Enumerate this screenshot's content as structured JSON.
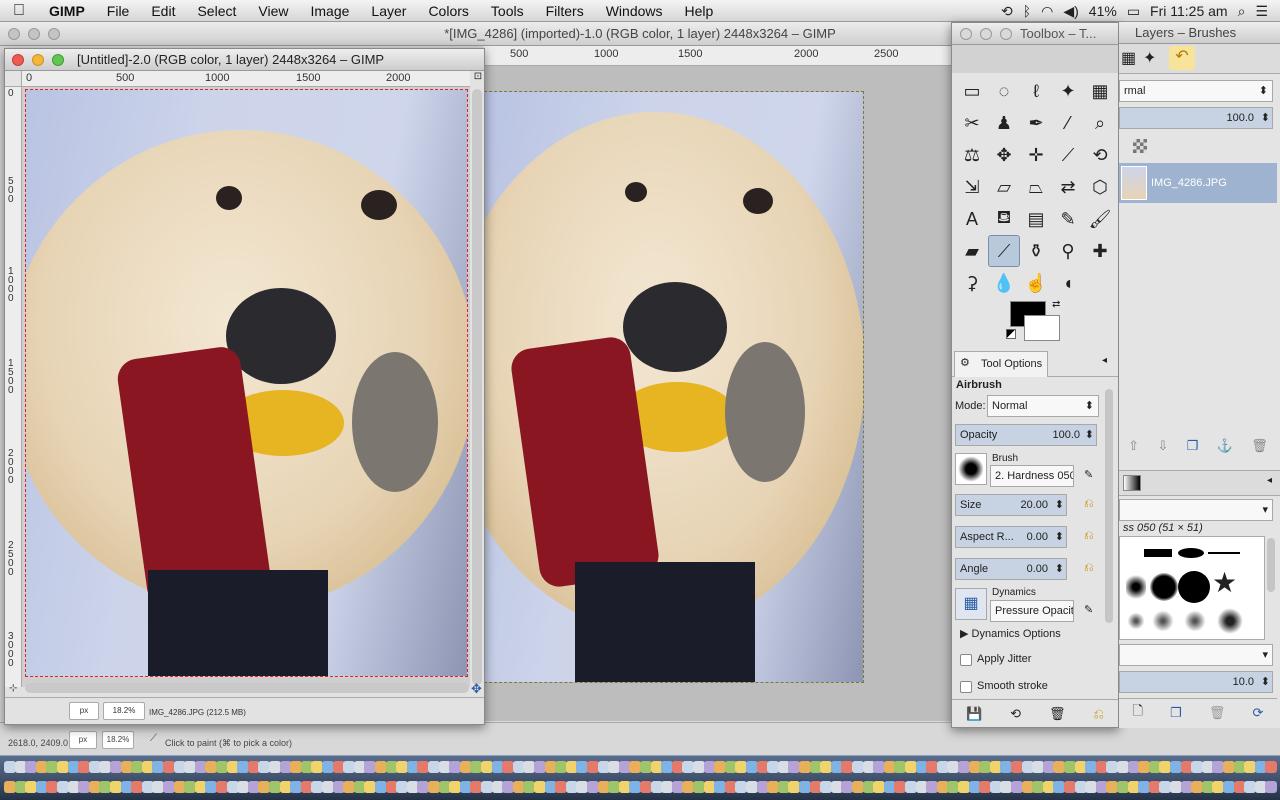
{
  "menubar": {
    "apple_icon": "apple-icon",
    "items": [
      "GIMP",
      "File",
      "Edit",
      "Select",
      "View",
      "Image",
      "Layer",
      "Colors",
      "Tools",
      "Filters",
      "Windows",
      "Help"
    ],
    "status": {
      "battery": "41%",
      "clock": "Fri 11:25 am"
    }
  },
  "main_window": {
    "title": "*[IMG_4286] (imported)-1.0 (RGB color, 1 layer) 2448x3264 – GIMP",
    "ruler_ticks": [
      "500",
      "1000",
      "1500",
      "2000",
      "2500"
    ],
    "status": {
      "coords": "2618.0, 2409.0",
      "unit": "px",
      "zoom": "18.2%",
      "message": "Click to paint (⌘ to pick a color)"
    }
  },
  "untitled_window": {
    "title": "[Untitled]-2.0 (RGB color, 1 layer) 2448x3264 – GIMP",
    "ruler_ticks": [
      "0",
      "500",
      "1000",
      "1500",
      "2000"
    ],
    "vruler_ticks": [
      "0",
      "5\n0\n0",
      "1\n0\n0\n0",
      "1\n5\n0\n0",
      "2\n0\n0\n0",
      "2\n5\n0\n0",
      "3\n0\n0\n0"
    ],
    "status": {
      "unit": "px",
      "zoom": "18.2%",
      "layer_info": "IMG_4286.JPG (212.5 MB)"
    }
  },
  "toolbox": {
    "title": "Toolbox – T...",
    "tools": [
      {
        "name": "rect-select-icon",
        "glyph": "▭"
      },
      {
        "name": "ellipse-select-icon",
        "glyph": "◌"
      },
      {
        "name": "lasso-icon",
        "glyph": "ℓ"
      },
      {
        "name": "fuzzy-select-icon",
        "glyph": "✦"
      },
      {
        "name": "color-select-icon",
        "glyph": "▦"
      },
      {
        "name": "scissors-icon",
        "glyph": "✂"
      },
      {
        "name": "foreground-select-icon",
        "glyph": "♟"
      },
      {
        "name": "paths-icon",
        "glyph": "✒"
      },
      {
        "name": "color-picker-icon",
        "glyph": "⁄"
      },
      {
        "name": "zoom-icon",
        "glyph": "⌕"
      },
      {
        "name": "measure-icon",
        "glyph": "⚖"
      },
      {
        "name": "move-icon",
        "glyph": "✥"
      },
      {
        "name": "align-icon",
        "glyph": "✛"
      },
      {
        "name": "crop-icon",
        "glyph": "⟋"
      },
      {
        "name": "rotate-icon",
        "glyph": "⟲"
      },
      {
        "name": "scale-icon",
        "glyph": "⇲"
      },
      {
        "name": "shear-icon",
        "glyph": "▱"
      },
      {
        "name": "perspective-icon",
        "glyph": "⏢"
      },
      {
        "name": "flip-icon",
        "glyph": "⇄"
      },
      {
        "name": "cage-icon",
        "glyph": "⬡"
      },
      {
        "name": "text-icon",
        "glyph": "A"
      },
      {
        "name": "bucket-fill-icon",
        "glyph": "⛾"
      },
      {
        "name": "blend-icon",
        "glyph": "▤"
      },
      {
        "name": "pencil-icon",
        "glyph": "✎"
      },
      {
        "name": "paintbrush-icon",
        "glyph": "🖌"
      },
      {
        "name": "eraser-icon",
        "glyph": "▰"
      },
      {
        "name": "airbrush-icon",
        "glyph": "⟋"
      },
      {
        "name": "ink-icon",
        "glyph": "⚱"
      },
      {
        "name": "clone-icon",
        "glyph": "⚲"
      },
      {
        "name": "heal-icon",
        "glyph": "✚"
      },
      {
        "name": "perspective-clone-icon",
        "glyph": "⚳"
      },
      {
        "name": "blur-icon",
        "glyph": "💧"
      },
      {
        "name": "smudge-icon",
        "glyph": "☝"
      },
      {
        "name": "dodge-burn-icon",
        "glyph": "◖"
      }
    ],
    "tool_options_tab": "Tool Options",
    "tool_name": "Airbrush",
    "mode_label": "Mode:",
    "mode_value": "Normal",
    "opacity_label": "Opacity",
    "opacity_value": "100.0",
    "brush_label": "Brush",
    "brush_value": "2. Hardness 050",
    "size_label": "Size",
    "size_value": "20.00",
    "aspect_label": "Aspect R...",
    "aspect_value": "0.00",
    "angle_label": "Angle",
    "angle_value": "0.00",
    "dynamics_label": "Dynamics",
    "dynamics_value": "Pressure Opacity",
    "dynamics_options": "Dynamics Options",
    "apply_jitter": "Apply Jitter",
    "smooth_stroke": "Smooth stroke"
  },
  "layers_dock": {
    "title": "Layers – Brushes",
    "mode_value": "rmal",
    "opacity_value": "100.0",
    "layer_name": "IMG_4286.JPG",
    "brush_caption": "ss 050 (51 × 51)",
    "spacing_value": "10.0"
  }
}
